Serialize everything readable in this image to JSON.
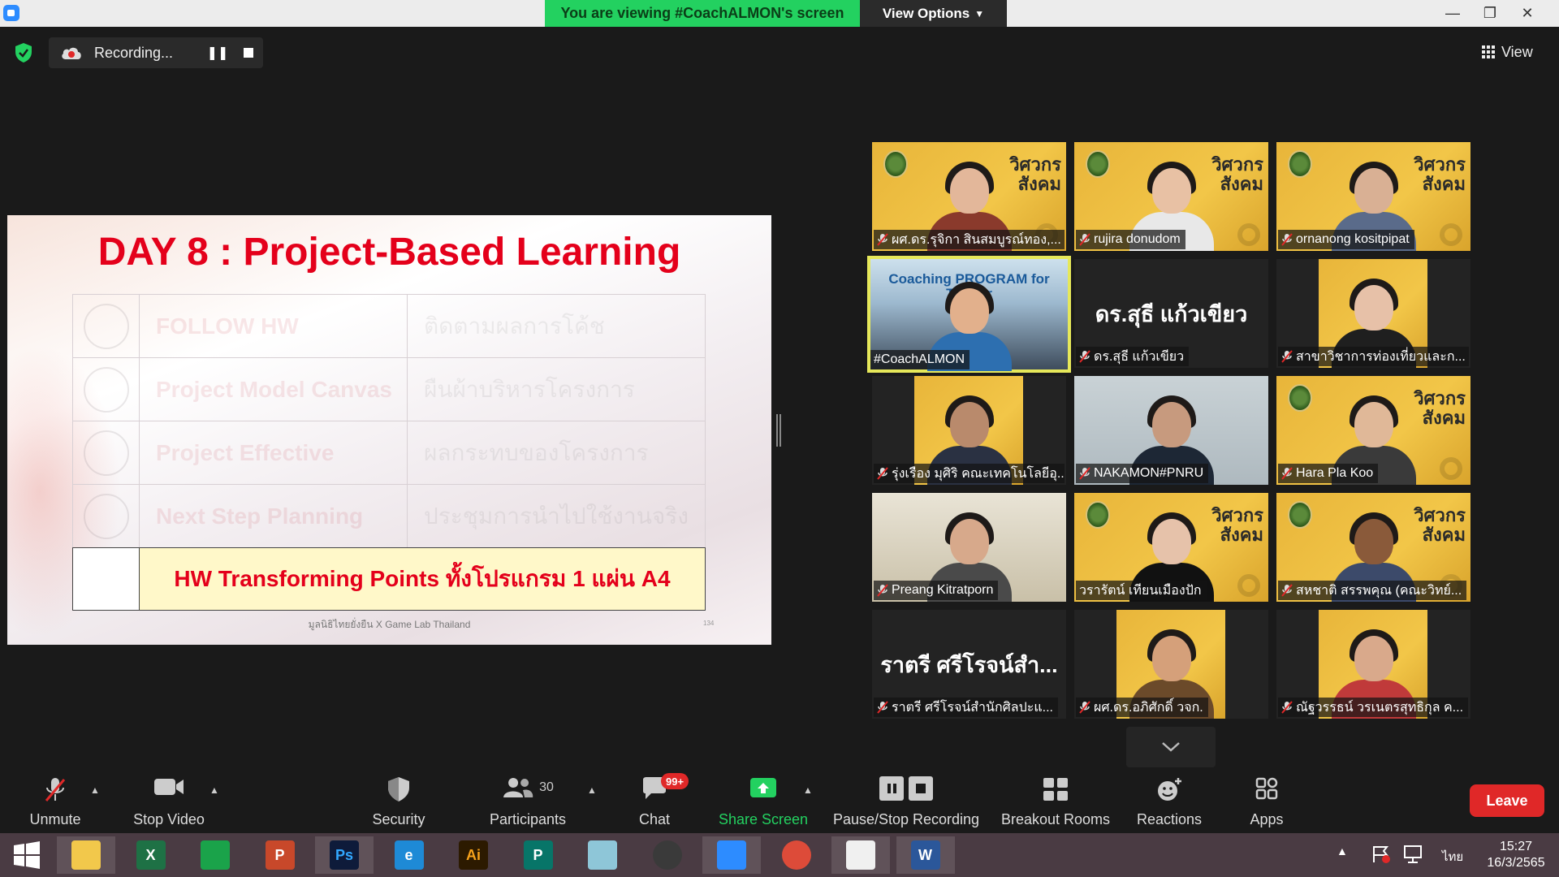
{
  "banner": {
    "viewing_text": "You are viewing #CoachALMON's screen",
    "view_options_label": "View Options"
  },
  "top": {
    "recording_label": "Recording...",
    "view_label": "View"
  },
  "slide": {
    "title": "DAY 8 : Project-Based Learning",
    "rows": [
      {
        "en": "FOLLOW HW",
        "th": "ติดตามผลการโค้ช"
      },
      {
        "en": "Project Model Canvas",
        "th": "ผืนผ้าบริหารโครงการ"
      },
      {
        "en": "Project Effective",
        "th": "ผลกระทบของโครงการ"
      },
      {
        "en": "Next Step Planning",
        "th": "ประชุมการนำไปใช้งานจริง"
      }
    ],
    "hw_text": "HW Transforming Points ทั้งโปรแกรม 1 แผ่น A4",
    "footer": "มูลนิธิไทยยั่งยืน X Game Lab Thailand",
    "page_no": "134"
  },
  "tile_logo_text": "วิศวกร สังคม",
  "participants": [
    {
      "name": "ผศ.ดร.รุจิกา สินสมบูรณ์ทอง,...",
      "muted": true,
      "type": "yellow"
    },
    {
      "name": "rujira donudom",
      "muted": true,
      "type": "yellow"
    },
    {
      "name": "ornanong kositpipat",
      "muted": true,
      "type": "yellow"
    },
    {
      "name": "#CoachALMON",
      "muted": false,
      "type": "active",
      "overlay": "Coaching PROGRAM for Trainer"
    },
    {
      "name": "ดร.สุธี แก้วเขียว",
      "muted": true,
      "type": "noVideo",
      "big": "ดร.สุธี แก้วเขียว"
    },
    {
      "name": "สาขาวิชาการท่องเที่ยวและก...",
      "muted": true,
      "type": "frame"
    },
    {
      "name": "รุ่งเรือง มุศิริ คณะเทคโนโลยีอุ...",
      "muted": true,
      "type": "frameDark"
    },
    {
      "name": "NAKAMON#PNRU",
      "muted": true,
      "type": "office"
    },
    {
      "name": "Hara Pla Koo",
      "muted": true,
      "type": "yellow"
    },
    {
      "name": "Preang Kitratporn",
      "muted": true,
      "type": "room"
    },
    {
      "name": "วรารัตน์ เทียนเมืองปัก",
      "muted": false,
      "type": "yellow"
    },
    {
      "name": "สหชาติ สรรพคุณ (คณะวิทย์...",
      "muted": true,
      "type": "yellow"
    },
    {
      "name": "ราตรี ศรีโรจน์สำนักศิลปะแ...",
      "muted": true,
      "type": "noVideo",
      "big": "ราตรี ศรีโรจน์สำ..."
    },
    {
      "name": "ผศ.ดร.อภิศักดิ์ วจก.",
      "muted": true,
      "type": "frame"
    },
    {
      "name": "ณัฐวรรธน์ วรเนตรสุทธิกุล ค...",
      "muted": true,
      "type": "frame"
    }
  ],
  "toolbar": {
    "unmute": "Unmute",
    "stop_video": "Stop Video",
    "security": "Security",
    "participants": "Participants",
    "participants_count": "30",
    "chat": "Chat",
    "chat_badge": "99+",
    "share_screen": "Share Screen",
    "pause_stop": "Pause/Stop Recording",
    "breakout": "Breakout Rooms",
    "reactions": "Reactions",
    "apps": "Apps",
    "leave": "Leave"
  },
  "taskbar": {
    "apps": [
      {
        "name": "explorer-app",
        "label": "",
        "color": "#f2c84b"
      },
      {
        "name": "excel-app",
        "label": "X",
        "color": "#1e7145"
      },
      {
        "name": "store-app",
        "label": "",
        "color": "#1aa34a"
      },
      {
        "name": "powerpoint-app",
        "label": "P",
        "color": "#c8482a"
      },
      {
        "name": "photoshop-app",
        "label": "Ps",
        "color": "#0e1b3a"
      },
      {
        "name": "ie-app",
        "label": "e",
        "color": "#1e8ad6"
      },
      {
        "name": "illustrator-app",
        "label": "Ai",
        "color": "#2c1a00"
      },
      {
        "name": "publisher-app",
        "label": "P",
        "color": "#077568"
      },
      {
        "name": "notepad-app",
        "label": "",
        "color": "#8ec6d8"
      },
      {
        "name": "photoscape-app",
        "label": "",
        "color": "#3a3a3a"
      },
      {
        "name": "zoom-app",
        "label": "",
        "color": "#2d8cff"
      },
      {
        "name": "chrome-app",
        "label": "",
        "color": "#dd4b39"
      },
      {
        "name": "paint-app",
        "label": "",
        "color": "#f0f0f0"
      },
      {
        "name": "word-app",
        "label": "W",
        "color": "#2b579a"
      }
    ],
    "lang": "ไทย",
    "time": "15:27",
    "date": "16/3/2565"
  },
  "colors": {
    "banner_green": "#23d160",
    "slide_red": "#e4001b",
    "leave_red": "#e02828",
    "share_green": "#23d160"
  }
}
